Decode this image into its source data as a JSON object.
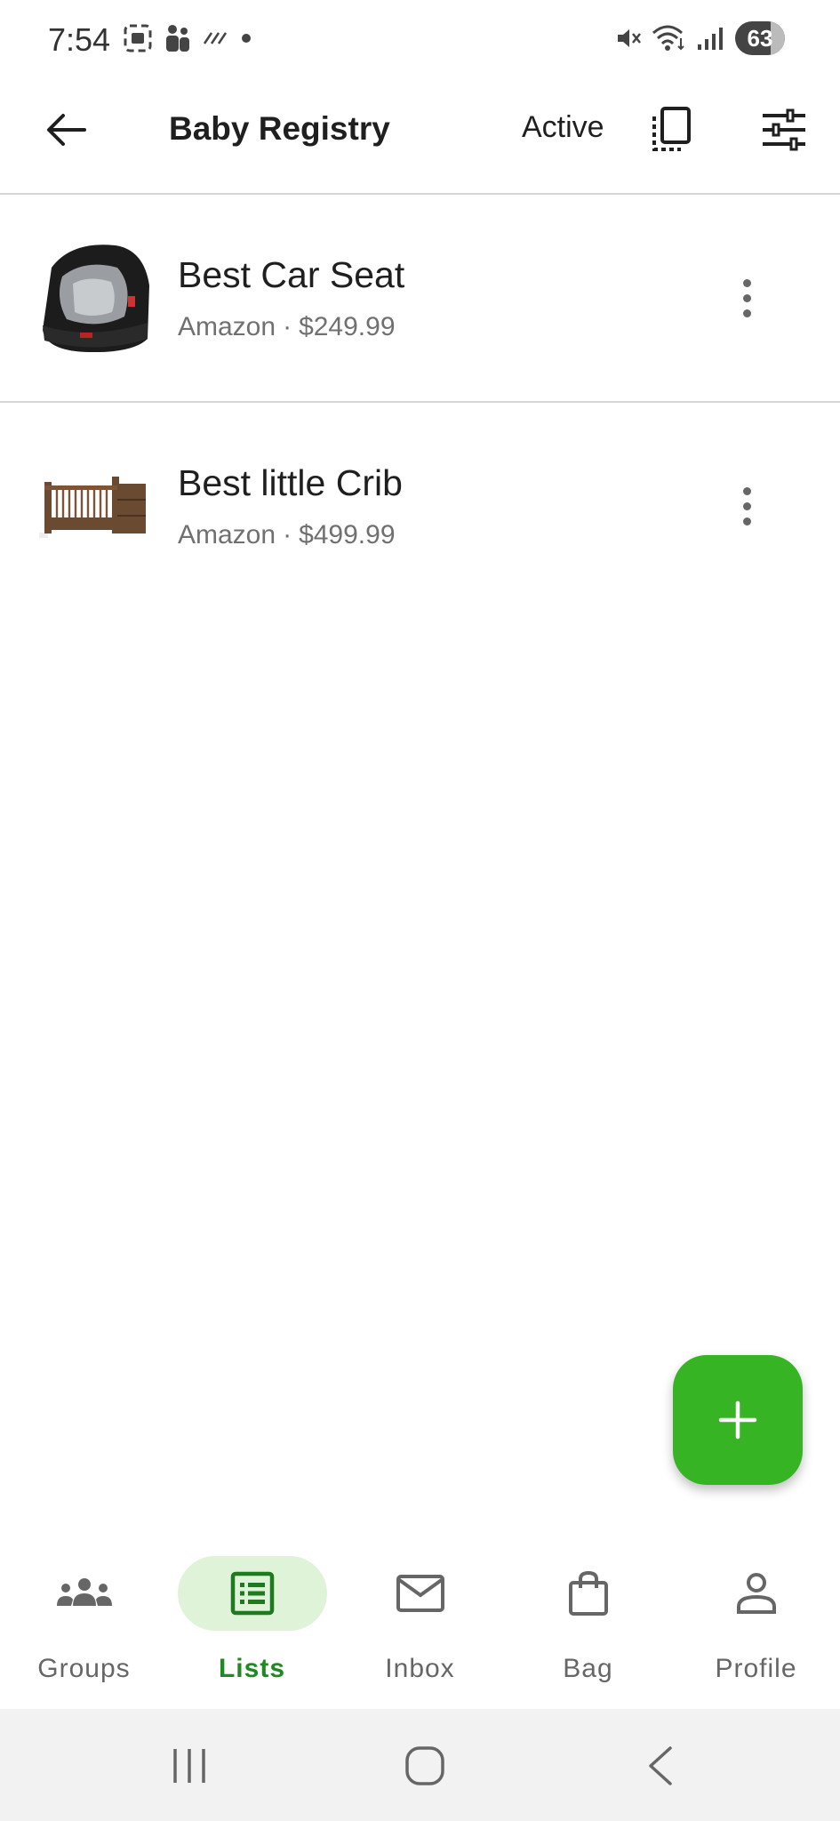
{
  "status_bar": {
    "time": "7:54",
    "battery": "63",
    "icons": [
      "screenshot-icon",
      "people-icon",
      "data-icon",
      "dot-icon",
      "mute-icon",
      "wifi-icon",
      "signal-icon",
      "battery-icon"
    ]
  },
  "header": {
    "title": "Baby Registry",
    "status": "Active",
    "icons": [
      "back-arrow-icon",
      "copy-icon",
      "filter-sliders-icon"
    ]
  },
  "items": [
    {
      "title": "Best Car Seat",
      "store": "Amazon",
      "separator": "·",
      "price": "$249.99",
      "image": "car-seat-image"
    },
    {
      "title": "Best little Crib",
      "store": "Amazon",
      "separator": "·",
      "price": "$499.99",
      "image": "crib-image"
    }
  ],
  "fab": {
    "icon": "plus-icon"
  },
  "bottom_nav": {
    "items": [
      {
        "label": "Groups",
        "icon": "groups-icon",
        "active": false
      },
      {
        "label": "Lists",
        "icon": "list-icon",
        "active": true
      },
      {
        "label": "Inbox",
        "icon": "mail-icon",
        "active": false
      },
      {
        "label": "Bag",
        "icon": "shopping-bag-icon",
        "active": false
      },
      {
        "label": "Profile",
        "icon": "person-icon",
        "active": false
      }
    ]
  },
  "colors": {
    "accent": "#36b424",
    "active_nav_bg": "#dff3d9",
    "active_nav_text": "#1f8a1f"
  }
}
